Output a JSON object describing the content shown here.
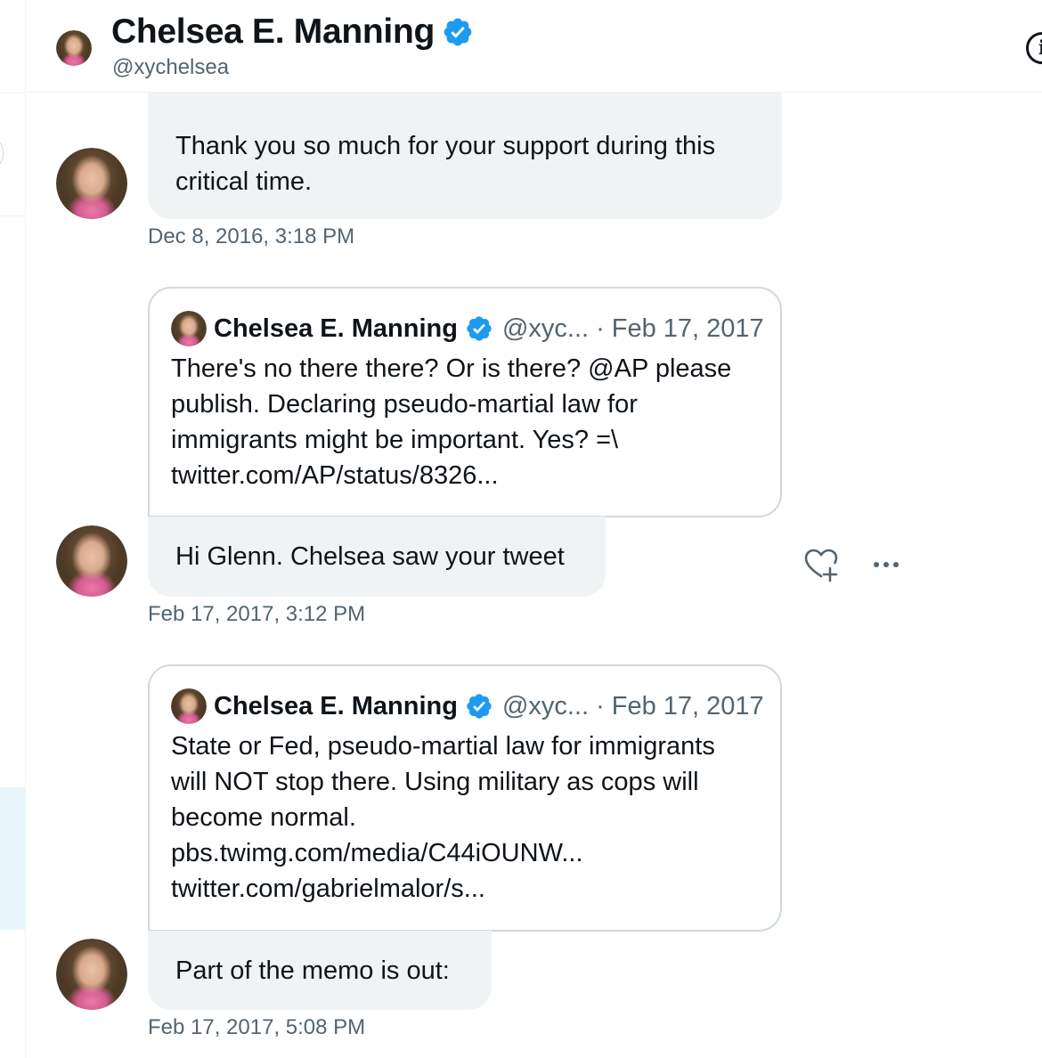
{
  "header": {
    "name": "Chelsea E. Manning",
    "handle": "@xychelsea",
    "info_icon": "i"
  },
  "messages": [
    {
      "text_lines": [
        "Thank you so much for your support during this",
        "critical time."
      ],
      "timestamp": "Dec 8, 2016, 3:18 PM"
    },
    {
      "quote": {
        "name": "Chelsea E. Manning",
        "handle": "@xyc...",
        "separator": "·",
        "date": "Feb 17, 2017",
        "body_lines": [
          "There's no there there? Or is there? @AP please",
          "publish. Declaring pseudo-martial law for",
          "immigrants might be important. Yes? =\\",
          "twitter.com/AP/status/8326..."
        ]
      },
      "text": "Hi Glenn. Chelsea saw your tweet",
      "timestamp": "Feb 17, 2017, 3:12 PM"
    },
    {
      "quote": {
        "name": "Chelsea E. Manning",
        "handle": "@xyc...",
        "separator": "·",
        "date": "Feb 17, 2017",
        "body_lines": [
          "State or Fed, pseudo-martial law for immigrants",
          "will NOT stop there. Using military as cops will",
          "become normal.",
          "pbs.twimg.com/media/C44iOUNW...",
          "twitter.com/gabrielmalor/s..."
        ]
      },
      "text": "Part of the memo is out:",
      "timestamp": "Feb 17, 2017, 5:08 PM"
    }
  ],
  "icons": {
    "verified": "verified-badge-icon",
    "react": "heart-plus-icon",
    "more": "more-horizontal-icon",
    "info": "info-icon"
  },
  "colors": {
    "verified_blue": "#1d9bf0",
    "bubble_bg": "#eff3f4",
    "secondary_text": "#536471",
    "border": "#cfd9de"
  }
}
